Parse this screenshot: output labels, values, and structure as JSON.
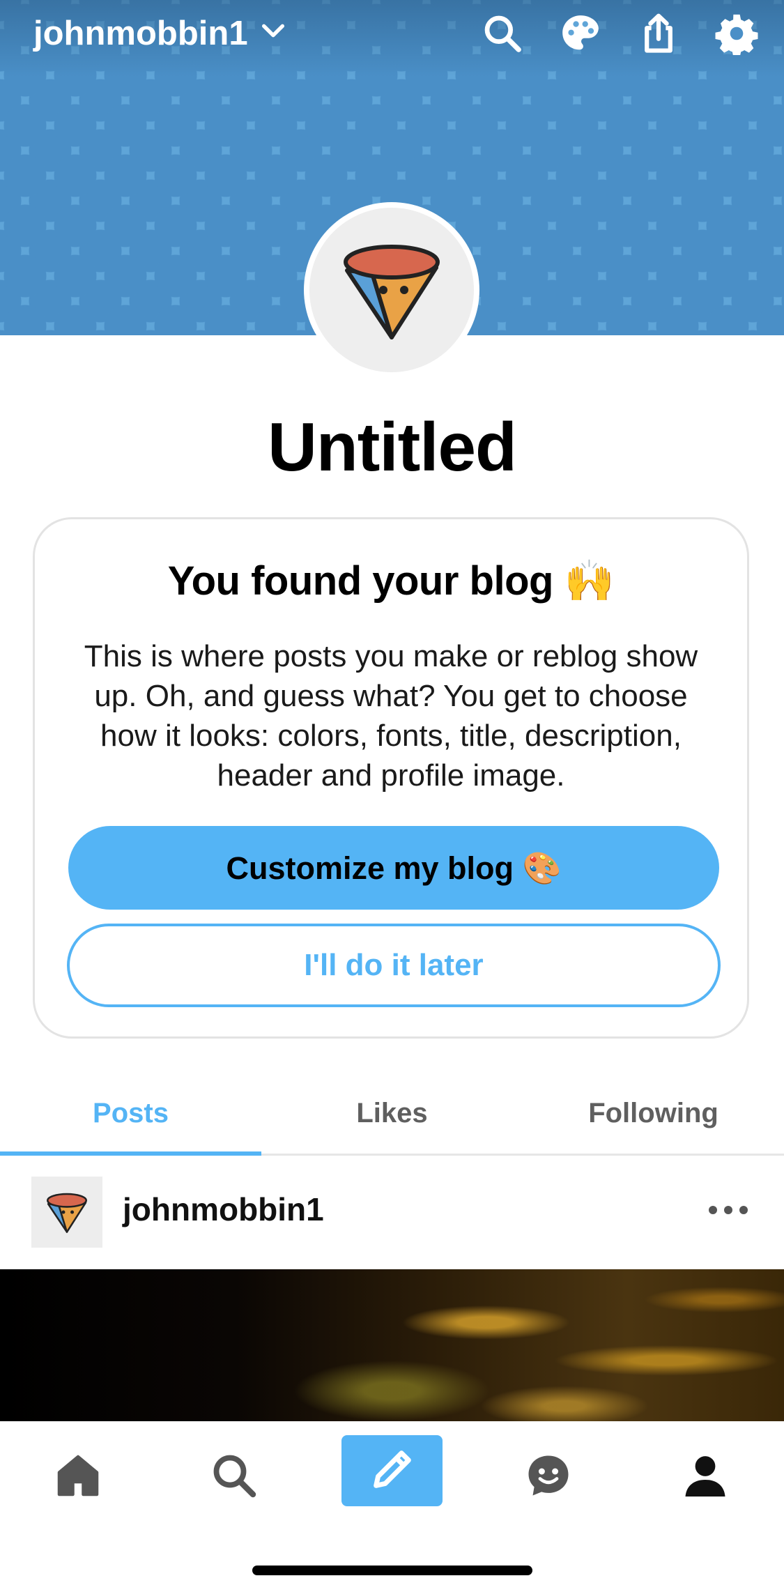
{
  "header": {
    "blog_name": "johnmobbin1",
    "icons": [
      "chevron-down-icon",
      "search-icon",
      "palette-icon",
      "share-icon",
      "gear-icon"
    ]
  },
  "profile": {
    "title": "Untitled"
  },
  "onboarding_card": {
    "heading": "You found your blog 🙌",
    "body": "This is where posts you make or reblog show up. Oh, and guess what? You get to choose how it looks: colors, fonts, title, description, header and profile image.",
    "primary_button": "Customize my blog 🎨",
    "secondary_button": "I'll do it later"
  },
  "tabs": [
    {
      "label": "Posts",
      "active": true
    },
    {
      "label": "Likes",
      "active": false
    },
    {
      "label": "Following",
      "active": false
    }
  ],
  "post": {
    "username": "johnmobbin1"
  },
  "bottom_nav": {
    "items": [
      "home-icon",
      "search-icon",
      "compose-icon",
      "activity-icon",
      "account-icon"
    ]
  },
  "colors": {
    "accent": "#54b4f5",
    "header_bg": "#5fa5d8",
    "header_dot": "#4a8fc7"
  }
}
